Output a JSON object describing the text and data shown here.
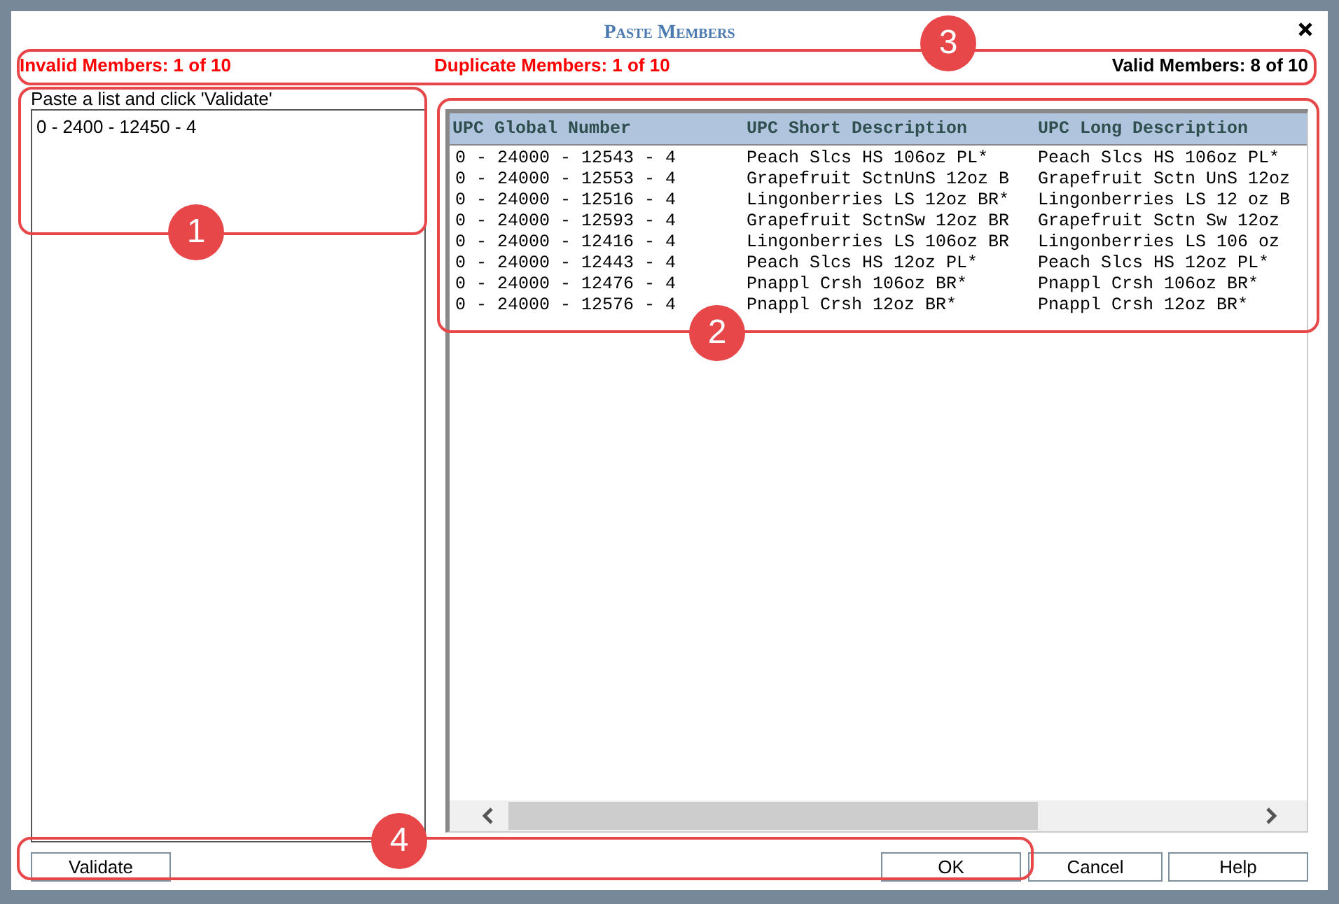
{
  "dialog": {
    "title": "Paste Members"
  },
  "summary": {
    "invalid": "Invalid Members: 1 of 10",
    "duplicate": "Duplicate Members: 1 of 10",
    "valid": "Valid Members: 8 of 10"
  },
  "paste_box": {
    "label": "Paste a list and click 'Validate'",
    "value": "0 - 2400 - 12450 - 4"
  },
  "table": {
    "columns": [
      "UPC Global Number",
      "UPC Short Description",
      "UPC Long Description"
    ],
    "rows": [
      [
        "0 - 24000 - 12543 - 4",
        "Peach Slcs HS 106oz PL*",
        "Peach Slcs HS 106oz PL*"
      ],
      [
        "0 - 24000 - 12553 - 4",
        "Grapefruit SctnUnS 12oz B",
        "Grapefruit Sctn UnS 12oz"
      ],
      [
        "0 - 24000 - 12516 - 4",
        "Lingonberries LS 12oz BR*",
        "Lingonberries LS 12 oz B"
      ],
      [
        "0 - 24000 - 12593 - 4",
        "Grapefruit SctnSw 12oz BR",
        "Grapefruit Sctn Sw 12oz"
      ],
      [
        "0 - 24000 - 12416 - 4",
        "Lingonberries LS 106oz BR",
        "Lingonberries LS 106 oz"
      ],
      [
        "0 - 24000 - 12443 - 4",
        "Peach Slcs HS 12oz PL*",
        "Peach Slcs HS 12oz PL*"
      ],
      [
        "0 - 24000 - 12476 - 4",
        "Pnappl Crsh 106oz BR*",
        "Pnappl Crsh 106oz BR*"
      ],
      [
        "0 - 24000 - 12576 - 4",
        "Pnappl Crsh 12oz BR*",
        "Pnappl Crsh 12oz BR*"
      ]
    ]
  },
  "buttons": {
    "validate": "Validate",
    "ok": "OK",
    "cancel": "Cancel",
    "help": "Help"
  },
  "callouts": [
    "1",
    "2",
    "3",
    "4"
  ]
}
